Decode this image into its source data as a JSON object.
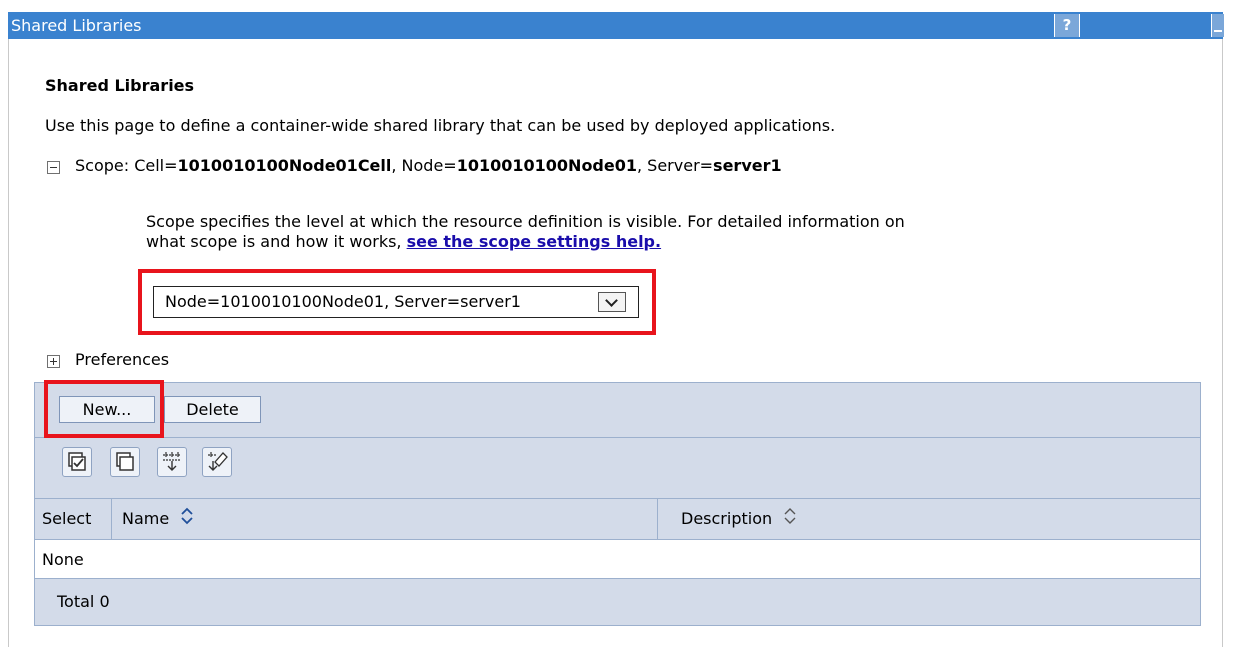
{
  "panel": {
    "title": "Shared Libraries",
    "help_label": "?",
    "heading": "Shared Libraries",
    "description": "Use this page to define a container-wide shared library that can be used by deployed applications."
  },
  "scope": {
    "prefix": "Scope: Cell=",
    "cell": "1010010100Node01Cell",
    "node_prefix": ", Node=",
    "node": "1010010100Node01",
    "server_prefix": ", Server=",
    "server": "server1",
    "help_text": "Scope specifies the level at which the resource definition is visible. For detailed information on what scope is and how it works,",
    "help_link": "see the scope settings help.",
    "selected_value": "Node=1010010100Node01, Server=server1"
  },
  "preferences_label": "Preferences",
  "buttons": {
    "new_label": "New...",
    "delete_label": "Delete"
  },
  "table_icons": [
    "select-all-icon",
    "deselect-all-icon",
    "show-filter-icon",
    "clear-filter-icon"
  ],
  "table": {
    "columns": [
      "Select",
      "Name",
      "Description"
    ],
    "empty_text": "None",
    "total_label": "Total 0"
  },
  "colors": {
    "title_bar": "#3a82cf",
    "table_band": "#d3dbe9",
    "highlight_box": "#e8141c",
    "link": "#1a0dab"
  }
}
